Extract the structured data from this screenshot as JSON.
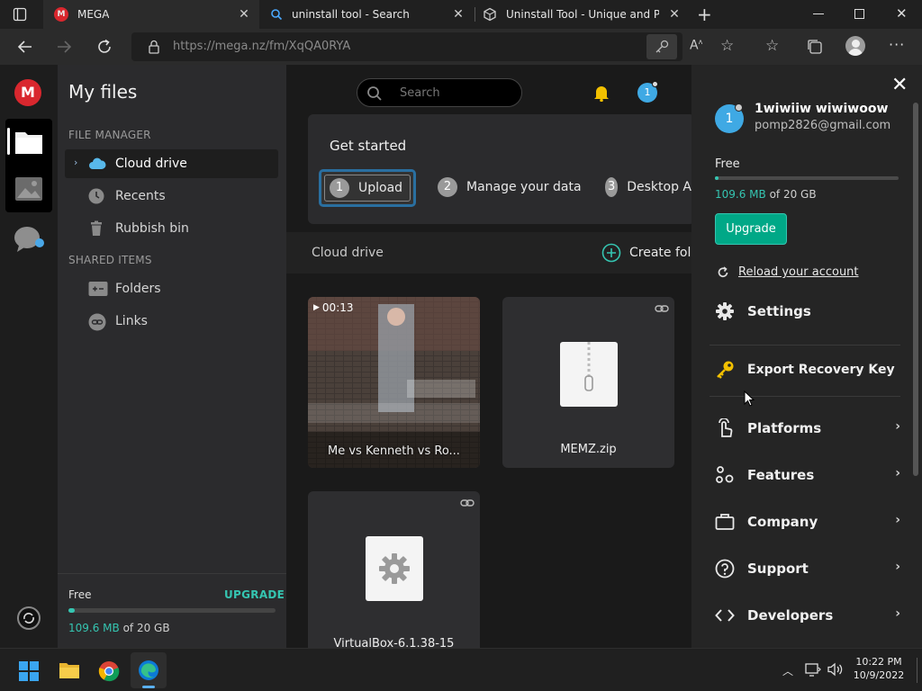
{
  "browser": {
    "tabs": [
      {
        "title": "MEGA",
        "favicon": "mega-logo-icon"
      },
      {
        "title": "uninstall tool - Search",
        "favicon": "search-icon"
      },
      {
        "title": "Uninstall Tool - Unique and Powe",
        "favicon": "cube-icon"
      }
    ],
    "url": "https://mega.nz/fm/XqQA0RYA",
    "colors": {
      "mega_red": "#d9272e",
      "accent": "#35c5b1",
      "active_tab": "#2b2b2b"
    }
  },
  "sidebar": {
    "title": "My files",
    "file_manager_label": "FILE MANAGER",
    "items": [
      {
        "label": "Cloud drive",
        "icon": "cloud-icon"
      },
      {
        "label": "Recents",
        "icon": "clock-icon"
      },
      {
        "label": "Rubbish bin",
        "icon": "trash-icon"
      }
    ],
    "shared_label": "SHARED ITEMS",
    "shared_items": [
      {
        "label": "Folders",
        "icon": "shared-folder-icon"
      },
      {
        "label": "Links",
        "icon": "link-icon"
      }
    ],
    "storage": {
      "plan": "Free",
      "upgrade": "UPGRADE",
      "used": "109.6 MB",
      "of_text": "of 20 GB",
      "fraction": 0.005
    }
  },
  "main": {
    "search_placeholder": "Search",
    "notification_badge": "1",
    "get_started": {
      "title": "Get started",
      "steps": [
        {
          "num": "1",
          "label": "Upload"
        },
        {
          "num": "2",
          "label": "Manage your data"
        },
        {
          "num": "3",
          "label": "Desktop A"
        }
      ]
    },
    "breadcrumb": "Cloud drive",
    "create_folder": "Create fold",
    "files": [
      {
        "name": "Me vs Kenneth vs Ro...",
        "duration": "00:13",
        "type": "video"
      },
      {
        "name": "MEMZ.zip",
        "type": "zip"
      },
      {
        "name": "VirtualBox-6.1.38-15",
        "type": "exe"
      }
    ]
  },
  "account_panel": {
    "avatar_initial": "1",
    "name": "1wiwiiw wiwiwoow",
    "email": "pomp2826@gmail.com",
    "plan": "Free",
    "used": "109.6 MB",
    "of_text": "of 20 GB",
    "storage_fraction": 0.005,
    "upgrade": "Upgrade",
    "reload": "Reload your account",
    "menu": [
      {
        "label": "Settings",
        "icon": "gear-icon"
      },
      {
        "label": "Export Recovery Key",
        "icon": "key-icon"
      },
      {
        "label": "Platforms",
        "icon": "hand-icon"
      },
      {
        "label": "Features",
        "icon": "features-icon"
      },
      {
        "label": "Company",
        "icon": "briefcase-icon"
      },
      {
        "label": "Support",
        "icon": "help-icon"
      },
      {
        "label": "Developers",
        "icon": "code-icon"
      }
    ]
  },
  "taskbar": {
    "time": "10:22 PM",
    "date": "10/9/2022"
  }
}
